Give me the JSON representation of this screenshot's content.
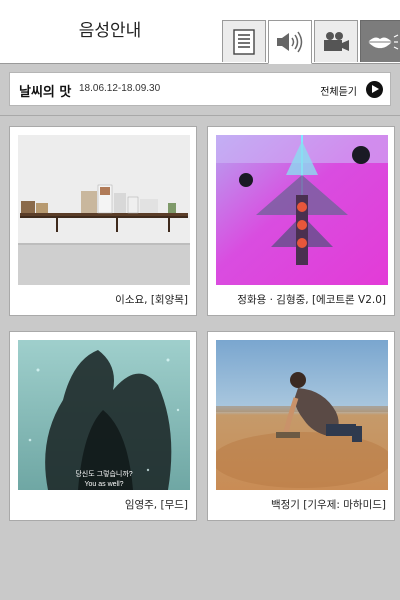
{
  "header": {
    "title": "음성안내",
    "tabs": [
      {
        "name": "document",
        "icon": "document-icon"
      },
      {
        "name": "audio",
        "icon": "speaker-icon",
        "active": true
      },
      {
        "name": "video",
        "icon": "video-camera-icon"
      },
      {
        "name": "sign",
        "icon": "lips-icon"
      }
    ]
  },
  "exhibition": {
    "title": "날씨의 맛",
    "dates": "18.06.12-18.09.30",
    "play_all_label": "전체듣기"
  },
  "artworks": [
    {
      "caption": "이소요, [회양목]"
    },
    {
      "caption": "정화용 · 김형중, [에코트론 V2.0]"
    },
    {
      "caption": "임영주, [무드]",
      "subtitle_ko": "당신도 그렇습니까?",
      "subtitle_en": "You as well?"
    },
    {
      "caption": "백정기 [기우제: 마하미드]"
    }
  ],
  "colors": {
    "background": "#c9c9c9",
    "card_border": "#a9a9a9",
    "sign_tab": "#7c7c7c",
    "play_button": "#111111"
  }
}
